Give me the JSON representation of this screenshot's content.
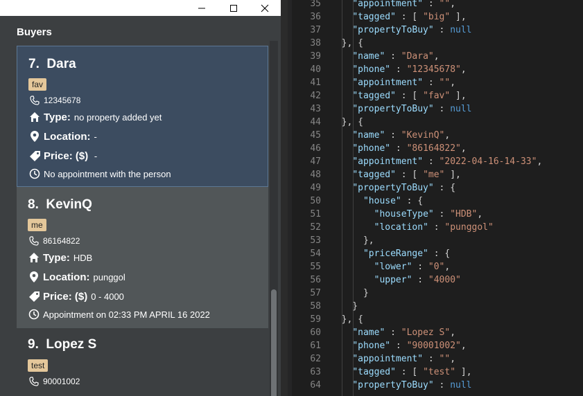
{
  "window": {
    "panel_title": "Buyers",
    "controls": {
      "minimize": "minimize",
      "maximize": "maximize",
      "close": "close"
    }
  },
  "buyers": [
    {
      "index_name": "7.  Dara",
      "tag": "fav",
      "phone": "12345678",
      "type_label": "Type:",
      "type_value": "no property added yet",
      "location_label": "Location:",
      "location_value": "-",
      "price_label": "Price: ($)",
      "price_value": " -",
      "appointment": "No appointment with the person"
    },
    {
      "index_name": "8.  KevinQ",
      "tag": "me",
      "phone": "86164822",
      "type_label": "Type:",
      "type_value": "HDB",
      "location_label": "Location:",
      "location_value": "punggol",
      "price_label": "Price: ($)",
      "price_value": "0 - 4000",
      "appointment": "Appointment on 02:33 PM APRIL 16 2022"
    },
    {
      "index_name": "9.  Lopez S",
      "tag": "test",
      "phone": "90001002"
    }
  ],
  "icons": {
    "phone": "phone-icon",
    "type": "home-icon",
    "location": "location-pin-icon",
    "price": "price-tag-icon",
    "appointment": "clock-icon"
  },
  "colors": {
    "selected_card": "#3c4c60",
    "alt_card": "#515658",
    "tag_bg": "#e4c79a",
    "json_key": "#9cdcfe",
    "json_string": "#ce9178",
    "json_null": "#569cd6"
  },
  "editor_lines": [
    {
      "n": "35",
      "code": [
        [
          "    ",
          ""
        ],
        [
          "\"appointment\"",
          "k"
        ],
        [
          " : ",
          ""
        ],
        [
          "\"\"",
          "s"
        ],
        [
          ",",
          ""
        ]
      ]
    },
    {
      "n": "36",
      "code": [
        [
          "    ",
          ""
        ],
        [
          "\"tagged\"",
          "k"
        ],
        [
          " : [ ",
          ""
        ],
        [
          "\"big\"",
          "s"
        ],
        [
          " ],",
          ""
        ]
      ]
    },
    {
      "n": "37",
      "code": [
        [
          "    ",
          ""
        ],
        [
          "\"propertyToBuy\"",
          "k"
        ],
        [
          " : ",
          ""
        ],
        [
          "null",
          "n"
        ]
      ]
    },
    {
      "n": "38",
      "code": [
        [
          "  }, {",
          ""
        ]
      ]
    },
    {
      "n": "39",
      "code": [
        [
          "    ",
          ""
        ],
        [
          "\"name\"",
          "k"
        ],
        [
          " : ",
          ""
        ],
        [
          "\"Dara\"",
          "s"
        ],
        [
          ",",
          ""
        ]
      ]
    },
    {
      "n": "40",
      "code": [
        [
          "    ",
          ""
        ],
        [
          "\"phone\"",
          "k"
        ],
        [
          " : ",
          ""
        ],
        [
          "\"12345678\"",
          "s"
        ],
        [
          ",",
          ""
        ]
      ]
    },
    {
      "n": "41",
      "code": [
        [
          "    ",
          ""
        ],
        [
          "\"appointment\"",
          "k"
        ],
        [
          " : ",
          ""
        ],
        [
          "\"\"",
          "s"
        ],
        [
          ",",
          ""
        ]
      ]
    },
    {
      "n": "42",
      "code": [
        [
          "    ",
          ""
        ],
        [
          "\"tagged\"",
          "k"
        ],
        [
          " : [ ",
          ""
        ],
        [
          "\"fav\"",
          "s"
        ],
        [
          " ],",
          ""
        ]
      ]
    },
    {
      "n": "43",
      "code": [
        [
          "    ",
          ""
        ],
        [
          "\"propertyToBuy\"",
          "k"
        ],
        [
          " : ",
          ""
        ],
        [
          "null",
          "n"
        ]
      ]
    },
    {
      "n": "44",
      "code": [
        [
          "  }, {",
          ""
        ]
      ]
    },
    {
      "n": "45",
      "code": [
        [
          "    ",
          ""
        ],
        [
          "\"name\"",
          "k"
        ],
        [
          " : ",
          ""
        ],
        [
          "\"KevinQ\"",
          "s"
        ],
        [
          ",",
          ""
        ]
      ]
    },
    {
      "n": "46",
      "code": [
        [
          "    ",
          ""
        ],
        [
          "\"phone\"",
          "k"
        ],
        [
          " : ",
          ""
        ],
        [
          "\"86164822\"",
          "s"
        ],
        [
          ",",
          ""
        ]
      ]
    },
    {
      "n": "47",
      "code": [
        [
          "    ",
          ""
        ],
        [
          "\"appointment\"",
          "k"
        ],
        [
          " : ",
          ""
        ],
        [
          "\"2022-04-16-14-33\"",
          "s"
        ],
        [
          ",",
          ""
        ]
      ]
    },
    {
      "n": "48",
      "code": [
        [
          "    ",
          ""
        ],
        [
          "\"tagged\"",
          "k"
        ],
        [
          " : [ ",
          ""
        ],
        [
          "\"me\"",
          "s"
        ],
        [
          " ],",
          ""
        ]
      ]
    },
    {
      "n": "49",
      "code": [
        [
          "    ",
          ""
        ],
        [
          "\"propertyToBuy\"",
          "k"
        ],
        [
          " : {",
          ""
        ]
      ]
    },
    {
      "n": "50",
      "code": [
        [
          "      ",
          ""
        ],
        [
          "\"house\"",
          "k"
        ],
        [
          " : {",
          ""
        ]
      ]
    },
    {
      "n": "51",
      "code": [
        [
          "        ",
          ""
        ],
        [
          "\"houseType\"",
          "k"
        ],
        [
          " : ",
          ""
        ],
        [
          "\"HDB\"",
          "s"
        ],
        [
          ",",
          ""
        ]
      ]
    },
    {
      "n": "52",
      "code": [
        [
          "        ",
          ""
        ],
        [
          "\"location\"",
          "k"
        ],
        [
          " : ",
          ""
        ],
        [
          "\"punggol\"",
          "s"
        ]
      ]
    },
    {
      "n": "53",
      "code": [
        [
          "      },",
          ""
        ]
      ]
    },
    {
      "n": "54",
      "code": [
        [
          "      ",
          ""
        ],
        [
          "\"priceRange\"",
          "k"
        ],
        [
          " : {",
          ""
        ]
      ]
    },
    {
      "n": "55",
      "code": [
        [
          "        ",
          ""
        ],
        [
          "\"lower\"",
          "k"
        ],
        [
          " : ",
          ""
        ],
        [
          "\"0\"",
          "s"
        ],
        [
          ",",
          ""
        ]
      ]
    },
    {
      "n": "56",
      "code": [
        [
          "        ",
          ""
        ],
        [
          "\"upper\"",
          "k"
        ],
        [
          " : ",
          ""
        ],
        [
          "\"4000\"",
          "s"
        ]
      ]
    },
    {
      "n": "57",
      "code": [
        [
          "      }",
          ""
        ]
      ]
    },
    {
      "n": "58",
      "code": [
        [
          "    }",
          ""
        ]
      ]
    },
    {
      "n": "59",
      "code": [
        [
          "  }, {",
          ""
        ]
      ]
    },
    {
      "n": "60",
      "code": [
        [
          "    ",
          ""
        ],
        [
          "\"name\"",
          "k"
        ],
        [
          " : ",
          ""
        ],
        [
          "\"Lopez S\"",
          "s"
        ],
        [
          ",",
          ""
        ]
      ]
    },
    {
      "n": "61",
      "code": [
        [
          "    ",
          ""
        ],
        [
          "\"phone\"",
          "k"
        ],
        [
          " : ",
          ""
        ],
        [
          "\"90001002\"",
          "s"
        ],
        [
          ",",
          ""
        ]
      ]
    },
    {
      "n": "62",
      "code": [
        [
          "    ",
          ""
        ],
        [
          "\"appointment\"",
          "k"
        ],
        [
          " : ",
          ""
        ],
        [
          "\"\"",
          "s"
        ],
        [
          ",",
          ""
        ]
      ]
    },
    {
      "n": "63",
      "code": [
        [
          "    ",
          ""
        ],
        [
          "\"tagged\"",
          "k"
        ],
        [
          " : [ ",
          ""
        ],
        [
          "\"test\"",
          "s"
        ],
        [
          " ],",
          ""
        ]
      ]
    },
    {
      "n": "64",
      "code": [
        [
          "    ",
          ""
        ],
        [
          "\"propertyToBuy\"",
          "k"
        ],
        [
          " : ",
          ""
        ],
        [
          "null",
          "n"
        ]
      ]
    }
  ]
}
